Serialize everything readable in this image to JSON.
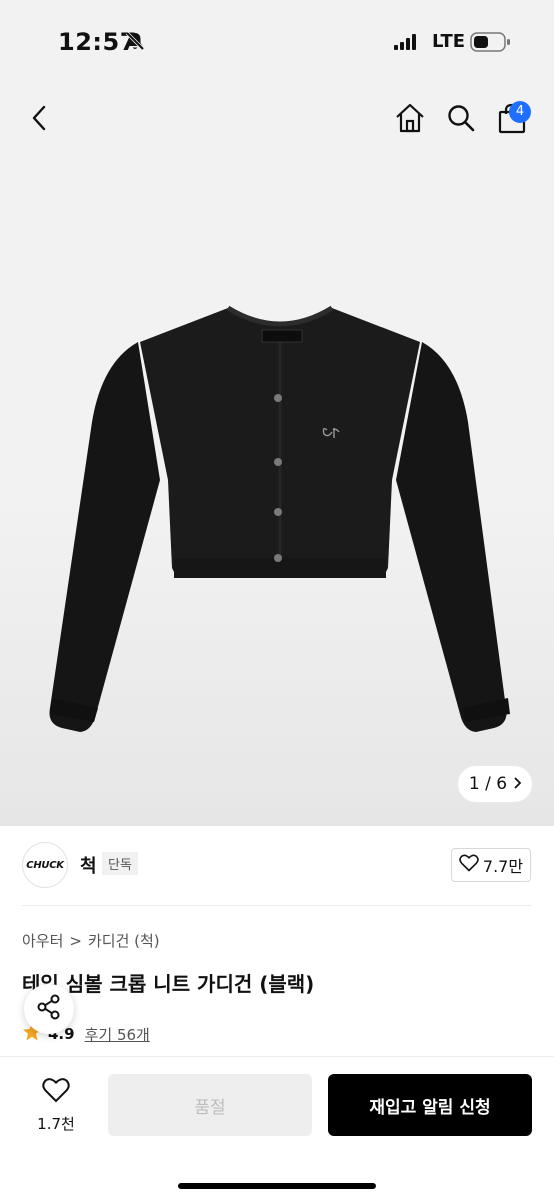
{
  "status_bar": {
    "time": "12:57",
    "network": "LTE"
  },
  "icons": {
    "back": "chevron-left-icon",
    "home": "home-icon",
    "search": "search-icon",
    "cart": "shopping-bag-icon",
    "bell": "bell-slash-icon",
    "heart": "heart-icon",
    "share": "share-icon",
    "star": "star-icon"
  },
  "header": {
    "cart_count": "4"
  },
  "gallery": {
    "current": "1",
    "total": "6",
    "counter_text": "1 / 6"
  },
  "brand": {
    "logo_text": "CHUCK",
    "name": "척",
    "tag": "단독",
    "likes": "7.7만"
  },
  "breadcrumb": {
    "level1": "아우터",
    "separator": ">",
    "level2": "카디건 (척)"
  },
  "product": {
    "title": "테일 심볼 크롭 니트 가디건 (블랙)",
    "rating": "4.9",
    "reviews": "후기 56개"
  },
  "bottom_bar": {
    "wishlist_count": "1.7천",
    "soldout_label": "품절",
    "restock_label": "재입고 알림 신청"
  },
  "colors": {
    "badge": "#1f6fff",
    "star": "#f5a623",
    "primary_button": "#000000",
    "disabled_button": "#eeeeee"
  }
}
